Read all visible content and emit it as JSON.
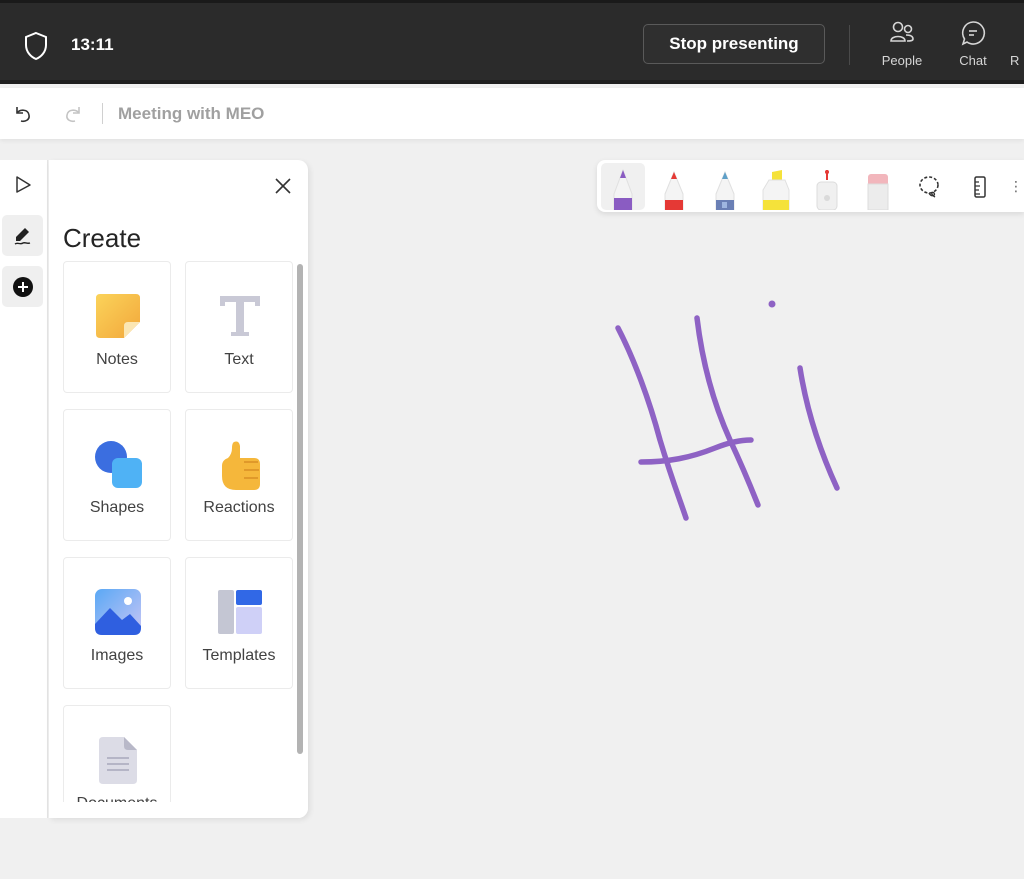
{
  "topbar": {
    "time": "13:11",
    "stop_presenting_label": "Stop presenting",
    "actions": [
      {
        "label": "People",
        "icon": "people-icon"
      },
      {
        "label": "Chat",
        "icon": "chat-icon"
      },
      {
        "label": "R",
        "icon": "truncated"
      }
    ]
  },
  "header": {
    "meeting_title": "Meeting with MEO",
    "undo_icon": "undo-icon",
    "redo_icon": "redo-icon"
  },
  "tool_rail": [
    {
      "name": "select",
      "icon": "pointer-icon"
    },
    {
      "name": "ink",
      "icon": "pen-icon",
      "active": true
    },
    {
      "name": "add",
      "icon": "add-circle-icon"
    }
  ],
  "create_panel": {
    "title": "Create",
    "items": [
      {
        "label": "Notes",
        "icon": "sticky-note-icon"
      },
      {
        "label": "Text",
        "icon": "text-icon"
      },
      {
        "label": "Shapes",
        "icon": "shapes-icon"
      },
      {
        "label": "Reactions",
        "icon": "thumbs-up-icon"
      },
      {
        "label": "Images",
        "icon": "image-icon"
      },
      {
        "label": "Templates",
        "icon": "templates-icon"
      },
      {
        "label": "Documents",
        "icon": "document-icon"
      }
    ]
  },
  "ink_toolbar": {
    "tools": [
      {
        "name": "pen-purple",
        "color": "#8a5cc2",
        "active": true
      },
      {
        "name": "pen-red",
        "color": "#e53935"
      },
      {
        "name": "pen-galaxy",
        "color": "#6a7fb5"
      },
      {
        "name": "highlighter-yellow",
        "color": "#f5e23a"
      },
      {
        "name": "laser-pointer",
        "color": "#e53935"
      },
      {
        "name": "eraser",
        "color": "#f2b6bc"
      },
      {
        "name": "lasso-select",
        "icon": "lasso-icon"
      },
      {
        "name": "ruler",
        "icon": "ruler-icon"
      }
    ]
  },
  "canvas": {
    "ink_color": "#8e62c4",
    "drawn_text": "Hi"
  }
}
